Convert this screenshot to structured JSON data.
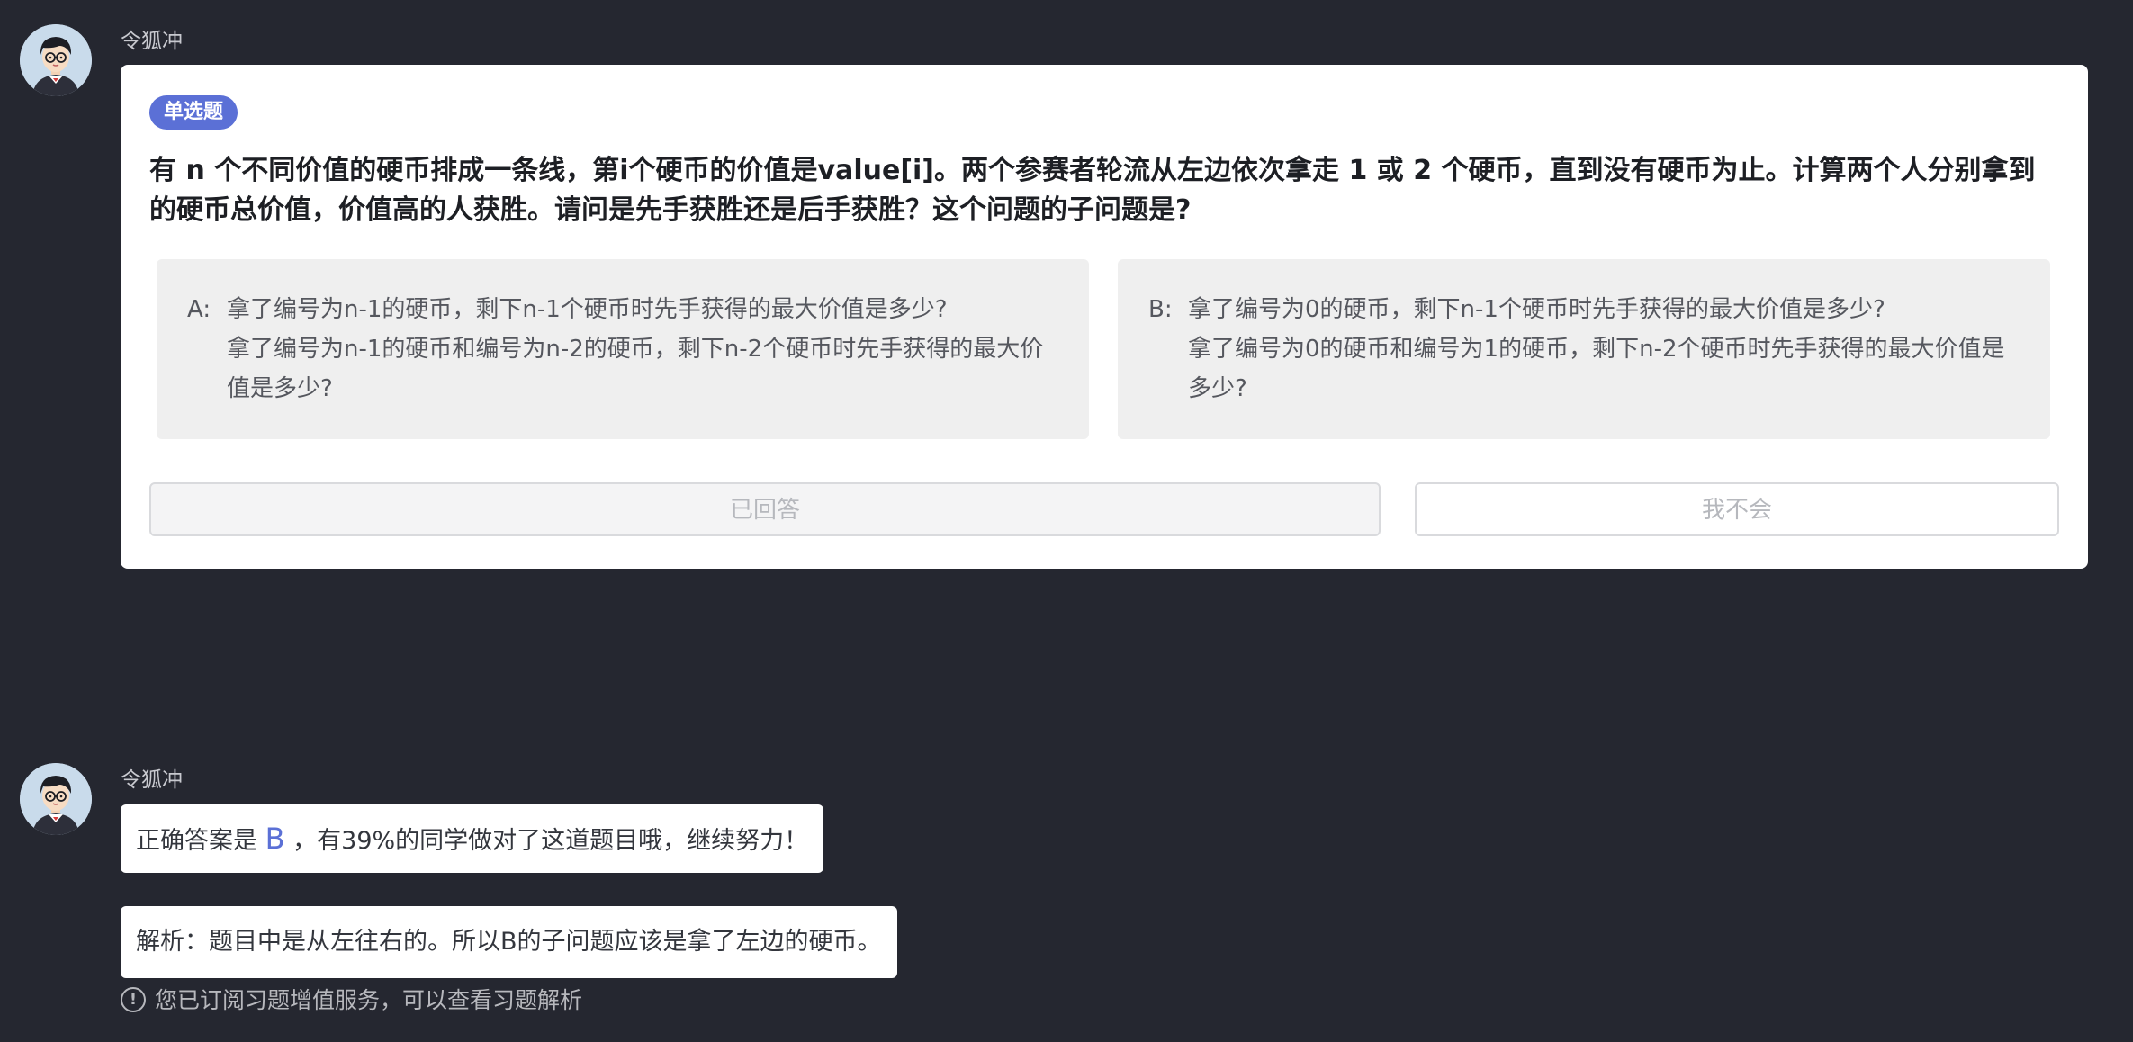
{
  "messages": [
    {
      "sender": "令狐冲",
      "question_card": {
        "badge": "单选题",
        "question": "有 n 个不同价值的硬币排成一条线，第i个硬币的价值是value[i]。两个参赛者轮流从左边依次拿走 1 或 2 个硬币，直到没有硬币为止。计算两个人分别拿到的硬币总价值，价值高的人获胜。请问是先手获胜还是后手获胜？这个问题的子问题是?",
        "options": [
          {
            "letter": "A:",
            "line1": "拿了编号为n-1的硬币，剩下n-1个硬币时先手获得的最大价值是多少?",
            "line2": "拿了编号为n-1的硬币和编号为n-2的硬币，剩下n-2个硬币时先手获得的最大价值是多少?"
          },
          {
            "letter": "B:",
            "line1": "拿了编号为0的硬币，剩下n-1个硬币时先手获得的最大价值是多少?",
            "line2": "拿了编号为0的硬币和编号为1的硬币，剩下n-2个硬币时先手获得的最大价值是多少?"
          }
        ],
        "answered_button": "已回答",
        "dont_know_button": "我不会"
      }
    },
    {
      "sender": "令狐冲",
      "answer": {
        "prefix": "正确答案是",
        "letter": "B",
        "suffix": "，有39%的同学做对了这道题目哦，继续努力！"
      },
      "analysis": "解析：题目中是从左往右的。所以B的子问题应该是拿了左边的硬币。",
      "notice_icon": "!",
      "notice": "您已订阅习题增值服务，可以查看习题解析"
    }
  ],
  "colors": {
    "background": "#252730",
    "accent": "#5b70d6",
    "card": "#ffffff",
    "option_bg": "#efefef"
  },
  "icons": {
    "avatar": "cartoon-boy-with-glasses-avatar",
    "notice": "info-circle-icon"
  }
}
